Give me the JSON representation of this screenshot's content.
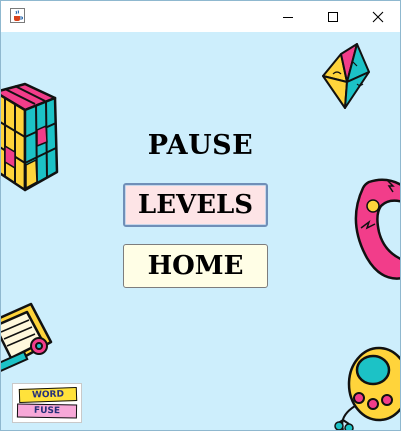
{
  "window": {
    "app_icon": "java-coffee-icon",
    "controls": {
      "minimize": "minimize-icon",
      "maximize": "maximize-icon",
      "close": "close-icon"
    }
  },
  "screen": {
    "title": "PAUSE",
    "buttons": {
      "levels": "LEVELS",
      "home": "HOME"
    }
  },
  "logo": {
    "line1": "WORD",
    "line2": "FUSE"
  },
  "colors": {
    "background": "#cdeefc",
    "levels_button": "#fde4e6",
    "home_button": "#fffee6"
  },
  "decorations": [
    "rubiks-cube",
    "paper-fortune-teller",
    "retro-phone-handset",
    "vhs-cassette",
    "tamagotchi-toy"
  ]
}
